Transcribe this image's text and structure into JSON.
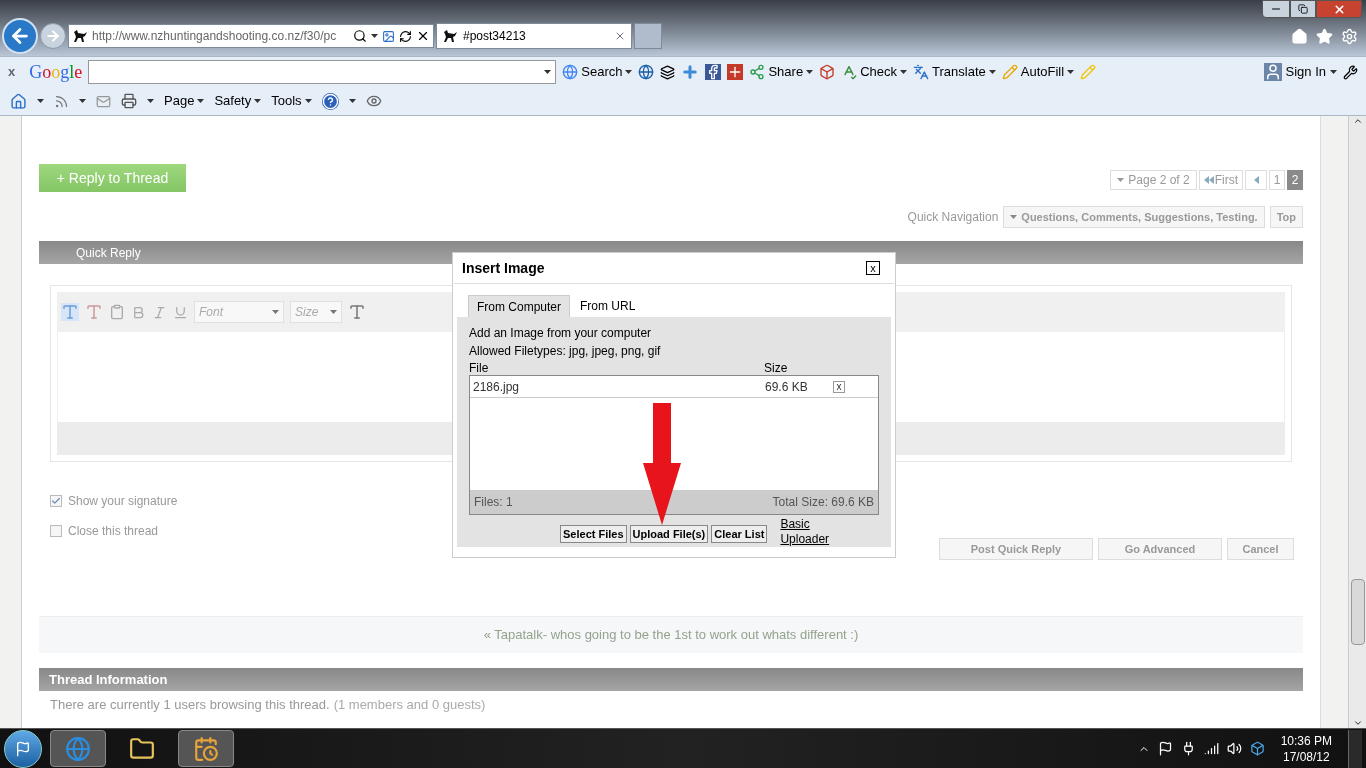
{
  "browser": {
    "address": "http://www.nzhuntingandshooting.co.nz/f30/pc",
    "tabs": [
      {
        "label": "#post34213",
        "selected": true
      }
    ]
  },
  "google_toolbar": {
    "close": "x",
    "logo": "Google",
    "items": [
      {
        "kind": "search",
        "label": "Search"
      },
      {
        "kind": "share",
        "label": "Share"
      },
      {
        "kind": "check",
        "label": "Check"
      },
      {
        "kind": "translate",
        "label": "Translate"
      },
      {
        "kind": "autofill",
        "label": "AutoFill"
      }
    ],
    "sign_in": "Sign In"
  },
  "command_bar": {
    "menus": [
      "Page",
      "Safety",
      "Tools"
    ]
  },
  "page": {
    "reply_button": "+ Reply to Thread",
    "pagination": {
      "summary": "Page 2 of 2",
      "first": "First",
      "pages": [
        {
          "label": "1",
          "selected": false
        },
        {
          "label": "2",
          "selected": true
        }
      ]
    },
    "quick_navigation": {
      "label": "Quick Navigation",
      "forum": "Questions, Comments, Suggestions, Testing.",
      "top": "Top"
    },
    "quick_reply": {
      "title": "Quick Reply",
      "font_placeholder": "Font",
      "size_placeholder": "Size",
      "options": [
        {
          "label": "Show your signature",
          "checked": true
        },
        {
          "label": "Close this thread",
          "checked": false
        }
      ],
      "buttons": [
        "Post Quick Reply",
        "Go Advanced",
        "Cancel"
      ]
    },
    "previous_thread": "« Tapatalk- whos going to be the 1st to work out whats different :)",
    "thread_information": {
      "title": "Thread Information",
      "text": "There are currently 1 users browsing this thread.",
      "note": "(1 members and 0 guests)"
    }
  },
  "dialog": {
    "title": "Insert Image",
    "close": "x",
    "tabs": [
      {
        "label": "From Computer",
        "selected": true
      },
      {
        "label": "From URL",
        "selected": false
      }
    ],
    "intro": "Add an Image from your computer",
    "allowed": "Allowed Filetypes: jpg, jpeg, png, gif",
    "columns": [
      "File",
      "Size"
    ],
    "files": [
      {
        "name": "2186.jpg",
        "size": "69.6 KB",
        "remove": "x"
      }
    ],
    "count": "Files: 1",
    "total": "Total Size: 69.6 KB",
    "buttons": [
      "Select Files",
      "Upload File(s)",
      "Clear List"
    ],
    "link": "Basic Uploader"
  },
  "taskbar": {
    "apps": [
      {
        "kind": "browser",
        "selected": true
      },
      {
        "kind": "folder",
        "selected": false
      },
      {
        "kind": "calendar",
        "selected": true
      }
    ],
    "time": "10:36 PM",
    "date": "17/08/12"
  }
}
